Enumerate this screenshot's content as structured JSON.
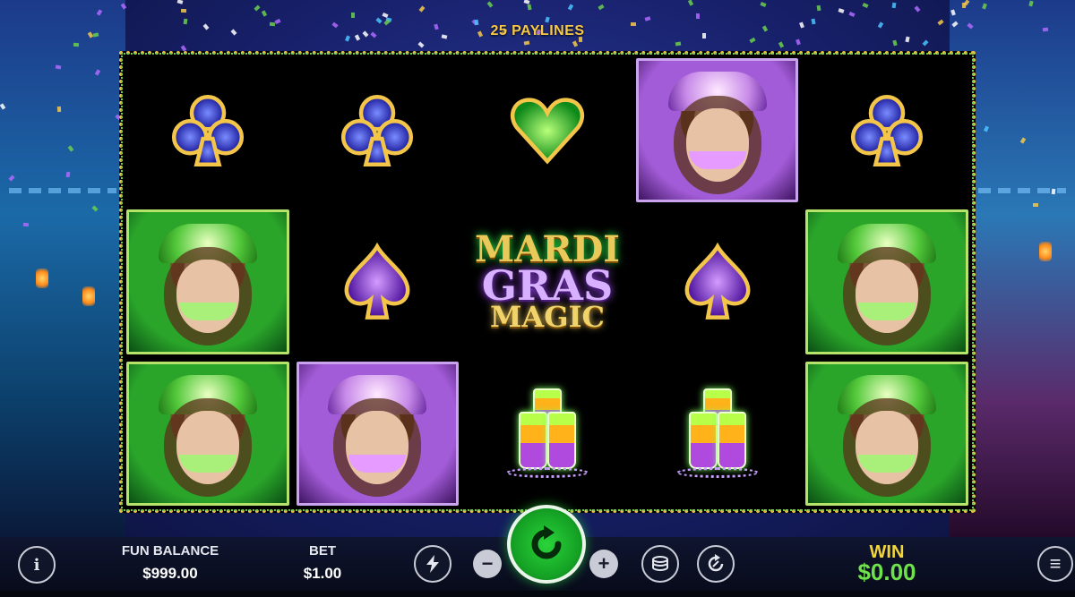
{
  "game": {
    "paylines_label": "25 PAYLINES",
    "logo": {
      "line1": "MARDI",
      "line2": "GRAS",
      "line3": "MAGIC"
    }
  },
  "reels": [
    [
      "club-blue",
      "girl-green",
      "girl-green"
    ],
    [
      "club-blue",
      "spade-purple",
      "girl-purple"
    ],
    [
      "heart-green",
      "logo",
      "shots"
    ],
    [
      "girl-purple",
      "spade-purple",
      "shots"
    ],
    [
      "club-blue",
      "girl-green",
      "girl-green"
    ]
  ],
  "hud": {
    "fun_balance_label": "FUN BALANCE",
    "fun_balance_value": "$999.00",
    "bet_label": "BET",
    "bet_value": "$1.00",
    "win_label": "WIN",
    "win_value": "$0.00",
    "info_icon": "i",
    "minus_icon": "−",
    "plus_icon": "+",
    "menu_icon": "≡"
  },
  "colors": {
    "accent_gold": "#f2d53a",
    "win_green": "#6ee24a",
    "spin_green": "#14a024"
  }
}
